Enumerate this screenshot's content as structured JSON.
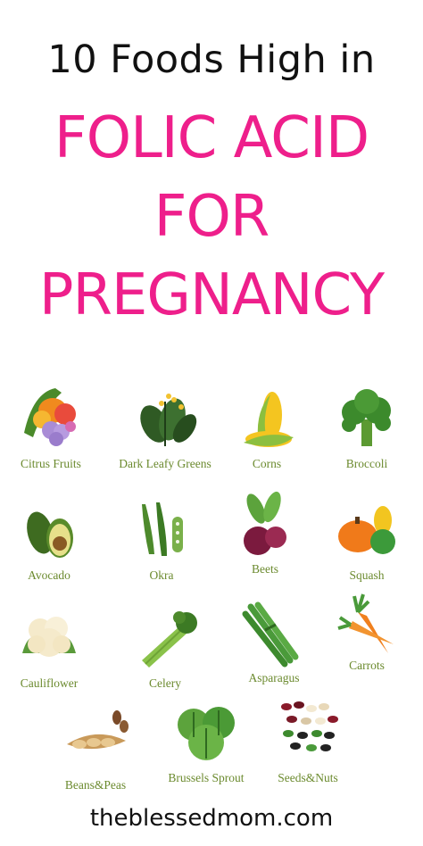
{
  "header": {
    "subtitle": "10 Foods High in",
    "title_lines": [
      "FOLIC ACID",
      "FOR",
      "PREGNANCY"
    ],
    "accent_color": "#ee1f8b"
  },
  "foods": [
    {
      "label": "Citrus Fruits",
      "icon": "citrus-fruits-icon"
    },
    {
      "label": "Dark Leafy Greens",
      "icon": "leafy-greens-icon"
    },
    {
      "label": "Corns",
      "icon": "corn-icon"
    },
    {
      "label": "Broccoli",
      "icon": "broccoli-icon"
    },
    {
      "label": "Avocado",
      "icon": "avocado-icon"
    },
    {
      "label": "Okra",
      "icon": "okra-icon"
    },
    {
      "label": "Beets",
      "icon": "beets-icon"
    },
    {
      "label": "Squash",
      "icon": "squash-icon"
    },
    {
      "label": "Cauliflower",
      "icon": "cauliflower-icon"
    },
    {
      "label": "Celery",
      "icon": "celery-icon"
    },
    {
      "label": "Asparagus",
      "icon": "asparagus-icon"
    },
    {
      "label": "Carrots",
      "icon": "carrots-icon"
    },
    {
      "label": "Beans&Peas",
      "icon": "beans-peas-icon"
    },
    {
      "label": "Brussels Sprout",
      "icon": "brussels-sprout-icon"
    },
    {
      "label": "Seeds&Nuts",
      "icon": "seeds-nuts-icon"
    }
  ],
  "footer": {
    "site": "theblessedmom.com"
  }
}
